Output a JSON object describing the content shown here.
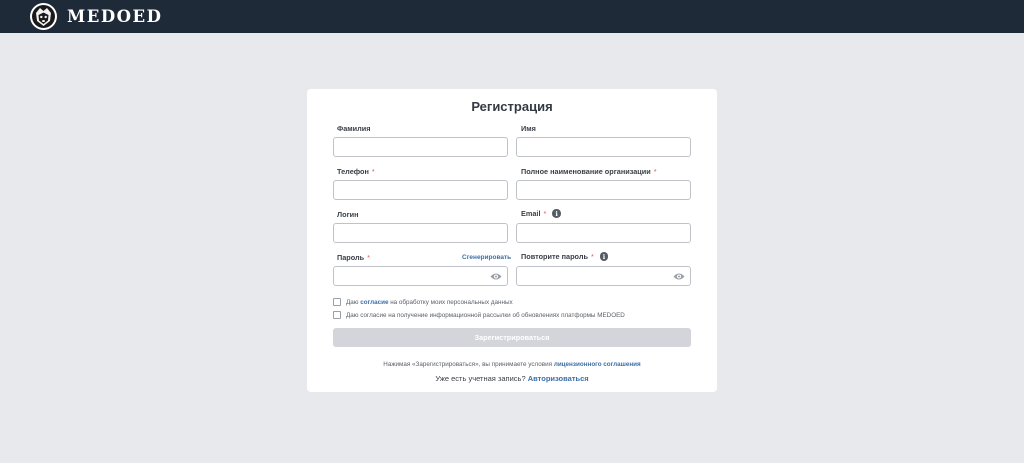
{
  "header": {
    "brand": "MEDOED"
  },
  "form": {
    "title": "Регистрация",
    "fields": {
      "lastname": {
        "label": "Фамилия",
        "value": ""
      },
      "firstname": {
        "label": "Имя",
        "value": ""
      },
      "phone": {
        "label": "Телефон",
        "value": ""
      },
      "org": {
        "label": "Полное наименование организации",
        "value": ""
      },
      "login": {
        "label": "Логин",
        "value": ""
      },
      "email": {
        "label": "Email",
        "value": ""
      },
      "password": {
        "label": "Пароль",
        "value": ""
      },
      "password_repeat": {
        "label": "Повторите пароль",
        "value": ""
      }
    },
    "required_mark": "*",
    "info_glyph": "i",
    "generate_link": "Сгенерировать",
    "consent1": {
      "prefix": "Даю ",
      "link": "согласие",
      "suffix": " на обработку моих персональных данных",
      "checked": false
    },
    "consent2": {
      "text": "Даю согласие на получение информационной рассылки об обновлениях платформы MEDOED",
      "checked": false
    },
    "submit_label": "Зарегистрироваться",
    "terms": {
      "prefix": "Нажимая «Зарегистрироваться», вы принимаете условия ",
      "link": "лицензионного соглашения"
    },
    "login_prompt": {
      "prefix": "Уже есть учетная запись? ",
      "link": "Авторизоваться"
    }
  },
  "colors": {
    "header_bg": "#1f2a38",
    "link": "#3d6fa8",
    "required": "#e05a5a",
    "button_disabled": "#d3d5da"
  }
}
